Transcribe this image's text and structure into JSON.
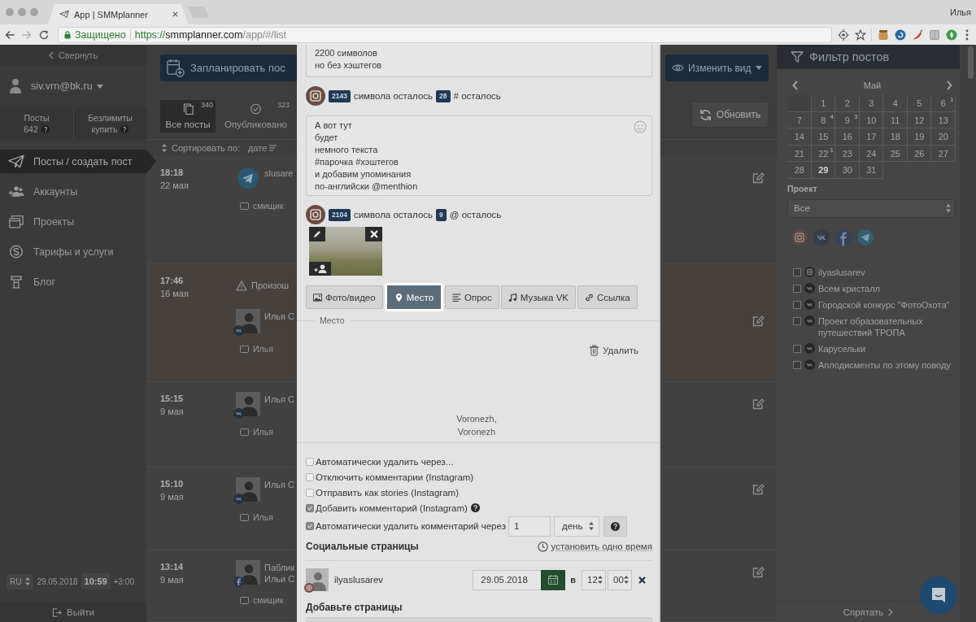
{
  "browser": {
    "tab_title": "App | SMMplanner",
    "profile_name": "Илья",
    "security_label": "Защищено",
    "url_scheme": "https://",
    "url_host": "smmplanner.com",
    "url_path": "/app/#/list"
  },
  "sidebar": {
    "collapse_label": "Свернуть",
    "user_email": "siv.vrn@bk.ru",
    "stats": [
      {
        "label": "Посты",
        "value": "642"
      },
      {
        "label": "Безлимиты",
        "value": "купить"
      }
    ],
    "nav": [
      {
        "label": "Посты / создать пост",
        "selected": true
      },
      {
        "label": "Аккаунты",
        "selected": false
      },
      {
        "label": "Проекты",
        "selected": false
      },
      {
        "label": "Тарифы и услуги",
        "selected": false
      },
      {
        "label": "Блог",
        "selected": false
      }
    ],
    "language": "RU",
    "date": "29.05.2018",
    "time": "10:59",
    "timezone": "+3:00",
    "logout_label": "Выйти"
  },
  "toolbar": {
    "schedule_button": "Запланировать пос",
    "view_button": "Изменить вид",
    "refresh_button": "Обновить",
    "tabs": [
      {
        "label": "Все посты",
        "count": "340",
        "selected": true
      },
      {
        "label": "Опубликовано",
        "count": "323",
        "selected": false
      }
    ],
    "sort_label": "Сортировать по:",
    "sort_value": "дате"
  },
  "posts": [
    {
      "time": "18:18",
      "date": "22 мая",
      "kind": "telegram",
      "error": false,
      "name_lines": [
        "slusare"
      ],
      "project": "смищик"
    },
    {
      "time": "17:46",
      "date": "16 мая",
      "kind": "vk",
      "error": true,
      "warning": "Произош",
      "name_lines": [
        "Илья С"
      ],
      "project": "Илья"
    },
    {
      "time": "15:15",
      "date": "9 мая",
      "kind": "vk",
      "error": false,
      "name_lines": [
        "Илья С"
      ],
      "project": "Илья"
    },
    {
      "time": "15:10",
      "date": "9 мая",
      "kind": "vk",
      "error": false,
      "name_lines": [
        "Илья С"
      ],
      "project": "Илья"
    },
    {
      "time": "13:14",
      "date": "9 мая",
      "kind": "facebook",
      "error": false,
      "name_lines": [
        "Паблик",
        "Ильи С"
      ],
      "project": "смищик"
    }
  ],
  "modal": {
    "preview_text": "2200 символов\nно без хэштегов",
    "hashtag_counter": {
      "chars": "2143",
      "chars_label": "символа осталось",
      "count": "28",
      "count_label": "# осталось"
    },
    "post_text": "А вот тут\nбудет\nнемного текста\n#парочка #хэштегов\nи добавим упоминания\nпо-английски @menthion",
    "mention_counter": {
      "chars": "2104",
      "chars_label": "символа осталось",
      "count": "9",
      "count_label": "@ осталось"
    },
    "attachments": [
      {
        "label": "Фото/видео",
        "selected": false
      },
      {
        "label": "Место",
        "selected": true
      },
      {
        "label": "Опрос",
        "selected": false
      },
      {
        "label": "Музыка VK",
        "selected": false
      },
      {
        "label": "Ссылка",
        "selected": false
      }
    ],
    "place_legend": "Место",
    "delete_label": "Удалить",
    "location": "Voronezh, Voronezh",
    "options": [
      {
        "kind": "plain",
        "label": "Автоматически удалить через...",
        "checked": false
      },
      {
        "kind": "plain",
        "label": "Отключить комментарии (Instagram)",
        "checked": false
      },
      {
        "kind": "plain",
        "label": "Отправить как stories (Instagram)",
        "checked": false
      },
      {
        "kind": "help",
        "label": "Добавить комментарий (Instagram)",
        "checked": true
      },
      {
        "kind": "duration",
        "label": "Автоматически удалить комментарий через",
        "checked": true,
        "amount": "1",
        "unit": "день"
      }
    ],
    "social_title": "Социальные страницы",
    "same_time_link": "установить одно время",
    "accounts": [
      {
        "name": "ilyaslusarev",
        "date": "29.05.2018",
        "at_label": "в",
        "hour": "12",
        "minute": "00"
      }
    ],
    "add_pages_title": "Добавьте страницы"
  },
  "filter": {
    "title": "Фильтр постов",
    "month": "Май",
    "weeks": [
      [
        {
          "kind": "empty"
        },
        {
          "kind": "day",
          "day": "1",
          "today": false
        },
        {
          "kind": "day",
          "day": "2",
          "today": false
        },
        {
          "kind": "day",
          "day": "3",
          "today": false
        },
        {
          "kind": "day",
          "day": "4",
          "today": false
        },
        {
          "kind": "day",
          "day": "5",
          "today": false
        },
        {
          "kind": "day",
          "day": "6",
          "count": "1",
          "today": false
        }
      ],
      [
        {
          "kind": "day",
          "day": "7",
          "today": false
        },
        {
          "kind": "day",
          "day": "8",
          "count": "4",
          "today": false
        },
        {
          "kind": "day",
          "day": "9",
          "count": "3",
          "today": false
        },
        {
          "kind": "day",
          "day": "10",
          "today": false
        },
        {
          "kind": "day",
          "day": "11",
          "today": false
        },
        {
          "kind": "day",
          "day": "12",
          "today": false
        },
        {
          "kind": "day",
          "day": "13",
          "today": false
        }
      ],
      [
        {
          "kind": "day",
          "day": "14",
          "today": false
        },
        {
          "kind": "day",
          "day": "15",
          "today": false
        },
        {
          "kind": "day",
          "day": "16",
          "today": false
        },
        {
          "kind": "day",
          "day": "17",
          "today": false
        },
        {
          "kind": "day",
          "day": "18",
          "today": false
        },
        {
          "kind": "day",
          "day": "19",
          "today": false
        },
        {
          "kind": "day",
          "day": "20",
          "today": false
        }
      ],
      [
        {
          "kind": "day",
          "day": "21",
          "today": false
        },
        {
          "kind": "day",
          "day": "22",
          "count": "1",
          "today": false
        },
        {
          "kind": "day",
          "day": "23",
          "today": false
        },
        {
          "kind": "day",
          "day": "24",
          "today": false
        },
        {
          "kind": "day",
          "day": "25",
          "today": false
        },
        {
          "kind": "day",
          "day": "26",
          "today": false
        },
        {
          "kind": "day",
          "day": "27",
          "today": false
        }
      ],
      [
        {
          "kind": "day",
          "day": "28",
          "today": false
        },
        {
          "kind": "day",
          "day": "29",
          "today": true
        },
        {
          "kind": "day",
          "day": "30",
          "today": false
        },
        {
          "kind": "day",
          "day": "31",
          "today": false
        }
      ]
    ],
    "project_label": "Проект",
    "project_value": "Все",
    "accounts": [
      {
        "kind": "instagram",
        "name": "ilyaslusarev",
        "checked": false
      },
      {
        "kind": "vk",
        "name": "Всем кристалл",
        "checked": false
      },
      {
        "kind": "vk",
        "name": "Городской конкурс \"ФотоОхота\"",
        "checked": false
      },
      {
        "kind": "vk",
        "name": "Проект образовательных путешествий ТРОПА",
        "checked": false
      },
      {
        "kind": "vk",
        "name": "Карусельки",
        "checked": false
      },
      {
        "kind": "vk",
        "name": "Аплодисменты по этому поводу",
        "checked": false
      }
    ],
    "hide_label": "Спрятать"
  }
}
